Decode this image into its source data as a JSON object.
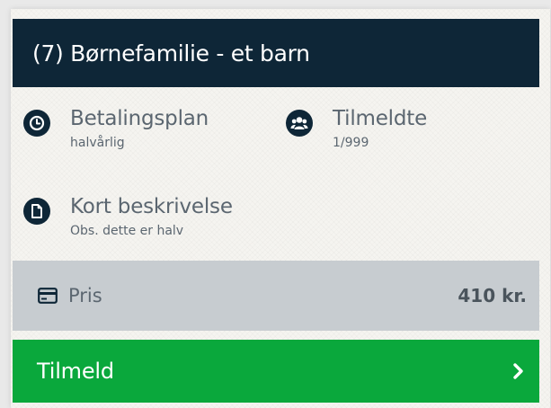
{
  "header": {
    "title": "(7) Børnefamilie - et barn"
  },
  "info": {
    "payment_plan": {
      "label": "Betalingsplan",
      "value": "halvårlig",
      "icon": "clock-icon"
    },
    "registered": {
      "label": "Tilmeldte",
      "value": "1/999",
      "icon": "users-icon"
    },
    "description": {
      "label": "Kort beskrivelse",
      "value": "Obs. dette er halv",
      "icon": "document-icon"
    }
  },
  "price": {
    "label": "Pris",
    "value": "410 kr.",
    "icon": "credit-card-icon"
  },
  "signup": {
    "label": "Tilmeld",
    "icon": "chevron-right-icon"
  },
  "colors": {
    "header_bg": "#0e2637",
    "price_bg": "#c7ccd0",
    "button_bg": "#0aa83c",
    "text_muted": "#5b6670"
  }
}
